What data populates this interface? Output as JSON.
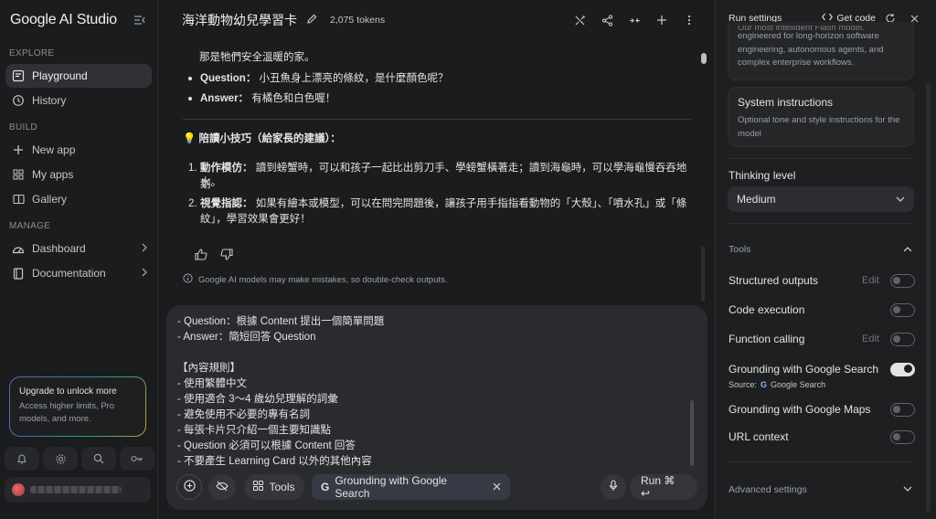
{
  "sidebar": {
    "logo": "Google AI Studio",
    "sections": {
      "explore": "EXPLORE",
      "build": "BUILD",
      "manage": "MANAGE"
    },
    "items": {
      "playground": "Playground",
      "history": "History",
      "new_app": "New app",
      "my_apps": "My apps",
      "gallery": "Gallery",
      "dashboard": "Dashboard",
      "documentation": "Documentation"
    },
    "upgrade": {
      "title": "Upgrade to unlock more",
      "desc": "Access higher limits, Pro models, and more."
    }
  },
  "header": {
    "title": "海洋動物幼兒學習卡",
    "tokens": "2,075 tokens"
  },
  "chat": {
    "partial_line": "那是牠們安全溫暖的家。",
    "question_label": "Question：",
    "question_text": "小丑魚身上漂亮的條紋，是什麼顏色呢？",
    "answer_label": "Answer：",
    "answer_text": "有橘色和白色喔！",
    "tips_title": "💡 陪讀小技巧（給家長的建議）：",
    "tip1_num": "1.",
    "tip1_label": "動作模仿：",
    "tip1_text": "讀到螃蟹時，可以和孩子一起比出剪刀手、學螃蟹橫著走；讀到海龜時，可以學海龜慢吞吞地划",
    "tip1_text2": "水。",
    "tip2_num": "2.",
    "tip2_label": "視覺指認：",
    "tip2_text": "如果有繪本或模型，可以在問完問題後，讓孩子用手指指看動物的「大殼」、「噴水孔」或「條",
    "tip2_text2": "紋」，學習效果會更好！",
    "disclaimer": "Google AI models may make mistakes, so double-check outputs."
  },
  "prompt": {
    "lines": [
      "- Question：根據 Content 提出一個簡單問題",
      "- Answer：簡短回答 Question",
      "",
      "【內容規則】",
      "- 使用繁體中文",
      "- 使用適合 3～4 歲幼兒理解的詞彙",
      "- 避免使用不必要的專有名詞",
      "- 每張卡片只介紹一個主要知識點",
      "- Question 必須可以根據 Content 回答",
      "- 不要產生 Learning Card 以外的其他內容"
    ],
    "tools_label": "Tools",
    "grounding_chip": "Grounding with Google Search",
    "run_label": "Run ⌘ ↩"
  },
  "run_settings": {
    "title": "Run settings",
    "get_code": "Get code",
    "model_desc": [
      "Our most intelligent Flash model,",
      "engineered for long-horizon software",
      "engineering, autonomous agents, and",
      "complex enterprise workflows."
    ],
    "sys_title": "System instructions",
    "sys_sub": "Optional tone and style instructions for the model",
    "thinking_label": "Thinking level",
    "thinking_value": "Medium",
    "tools_header": "Tools",
    "tools": {
      "structured": "Structured outputs",
      "code_exec": "Code execution",
      "function_calling": "Function calling",
      "grounding_search": "Grounding with Google Search",
      "grounding_maps": "Grounding with Google Maps",
      "url_context": "URL context"
    },
    "edit_label": "Edit",
    "source_label": "Source:",
    "source_value": "Google Search",
    "advanced": "Advanced settings"
  }
}
